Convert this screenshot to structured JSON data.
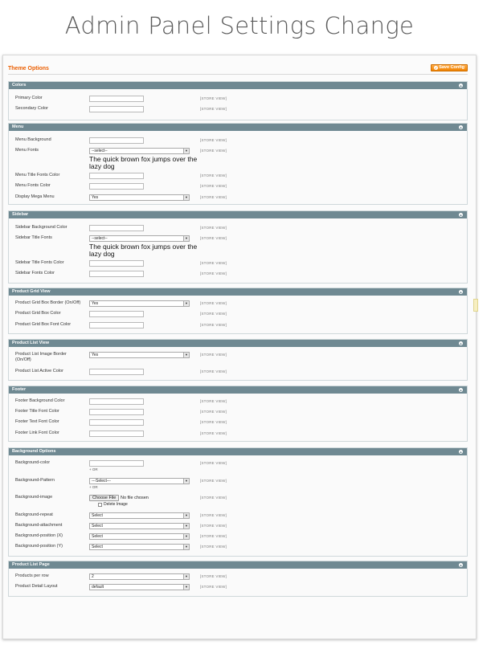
{
  "hero_title": "Admin Panel Settings Change",
  "page": {
    "title": "Theme Options",
    "save_label": "Save Config",
    "save_icon": "check-circle-icon"
  },
  "scope_label": "[STORE VIEW]",
  "sections": {
    "colors": {
      "title": "Colors",
      "primary": "Primary Color",
      "secondary": "Secondary Color"
    },
    "menu": {
      "title": "Menu",
      "background": "Menu Background",
      "fonts": "Menu Fonts",
      "fonts_value": "--select--",
      "fonts_preview": "The quick brown fox jumps over the lazy dog",
      "title_fonts_color": "Menu Title Fonts Color",
      "fonts_color": "Menu Fonts Color",
      "mega_menu": "Display Mega Menu",
      "mega_menu_value": "Yes"
    },
    "sidebar": {
      "title": "Sidebar",
      "background": "Sidebar Background Color",
      "title_fonts": "Sidebar Title Fonts",
      "title_fonts_value": "--select--",
      "fonts_preview": "The quick brown fox jumps over the lazy dog",
      "title_fonts_color": "Sidebar Title Fonts Color",
      "fonts_color": "Sidebar Fonts Color"
    },
    "grid": {
      "title": "Product Grid View",
      "border": "Product Grid Box Border (On/Off)",
      "border_value": "Yes",
      "box_color": "Product Grid Box Color",
      "font_color": "Product Grid Box Font Color"
    },
    "list": {
      "title": "Product List View",
      "image_border": "Product List Image Border (On/Off)",
      "image_border_value": "Yes",
      "active_color": "Product List Active Color"
    },
    "footer": {
      "title": "Footer",
      "background": "Footer Background Color",
      "title_font": "Footer Title Font Color",
      "text_font": "Footer Text Font Color",
      "link_font": "Footer Link Font Color"
    },
    "background": {
      "title": "Background Options",
      "color": "Background-color",
      "or_note": "+ OR",
      "pattern": "Background-Pattern",
      "pattern_value": "---Select---",
      "image": "Background-image",
      "choose_file": "Choose File",
      "no_file": "No file chosen",
      "delete_image": "Delete Image",
      "repeat": "Background-repeat",
      "attachment": "Background-attachment",
      "position_x": "Background-position (X)",
      "position_y": "Background-position (Y)",
      "select_value": "Select"
    },
    "list_page": {
      "title": "Product List Page",
      "per_row": "Products per row",
      "per_row_value": "2",
      "detail_layout": "Product Detail Layout",
      "detail_layout_value": "default"
    }
  },
  "colors": {
    "accent": "#eb5e00",
    "button": "#f18200",
    "section_header": "#6f8992"
  }
}
